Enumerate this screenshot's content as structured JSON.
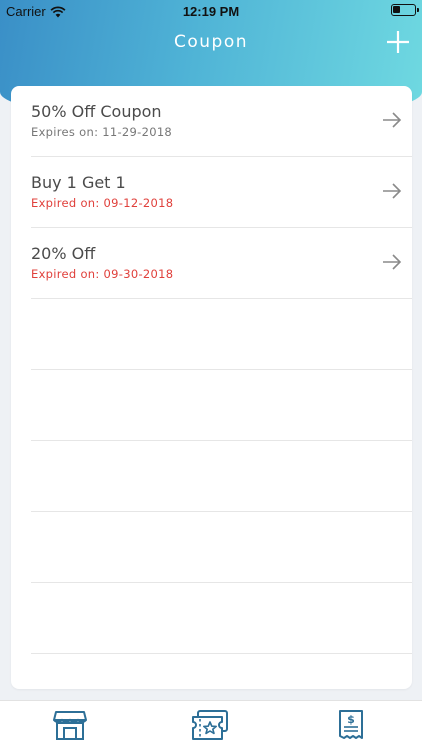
{
  "status_bar": {
    "carrier": "Carrier",
    "time": "12:19 PM",
    "wifi_icon": "wifi-icon",
    "battery_icon": "battery-icon"
  },
  "header": {
    "title": "Coupon",
    "add_icon": "plus-icon",
    "gradient_colors": [
      "#3a8fc7",
      "#6fd9e1"
    ]
  },
  "coupons": [
    {
      "title": "50% Off Coupon",
      "subtitle": "Expires on: 11-29-2018",
      "status": "active"
    },
    {
      "title": "Buy 1 Get 1",
      "subtitle": "Expired on: 09-12-2018",
      "status": "expired"
    },
    {
      "title": "20% Off",
      "subtitle": "Expired on: 09-30-2018",
      "status": "expired"
    }
  ],
  "colors": {
    "expired": "#e0403b",
    "active_subtitle": "#777777",
    "tab_icon": "#2d6f97"
  },
  "tabbar": {
    "items": [
      {
        "icon": "store-icon"
      },
      {
        "icon": "coupon-ticket-icon"
      },
      {
        "icon": "receipt-icon"
      }
    ]
  }
}
